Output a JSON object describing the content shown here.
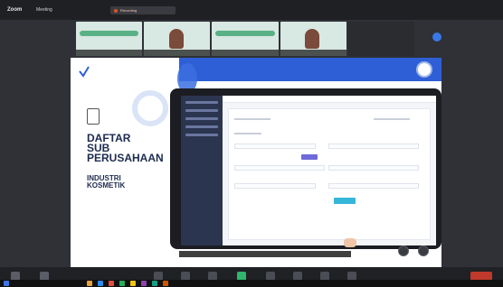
{
  "window": {
    "app_name": "Zoom",
    "meeting_label": "Meeting",
    "recording_text": "Recording"
  },
  "top_right": [
    "",
    "",
    "",
    ""
  ],
  "participants": [
    {
      "name": ""
    },
    {
      "name": ""
    },
    {
      "name": ""
    },
    {
      "name": ""
    },
    {
      "name": ""
    }
  ],
  "slide": {
    "title": "DAFTAR\nSUB\nPERUSAHAAN",
    "subtitle": "INDUSTRI\nKOSMETIK",
    "paragraphs": [
      "",
      ""
    ],
    "banner_text": "",
    "caption": ""
  },
  "colors": {
    "brand": "#2e5fd6",
    "title": "#1d2b4f",
    "toolbar": "#202124"
  }
}
